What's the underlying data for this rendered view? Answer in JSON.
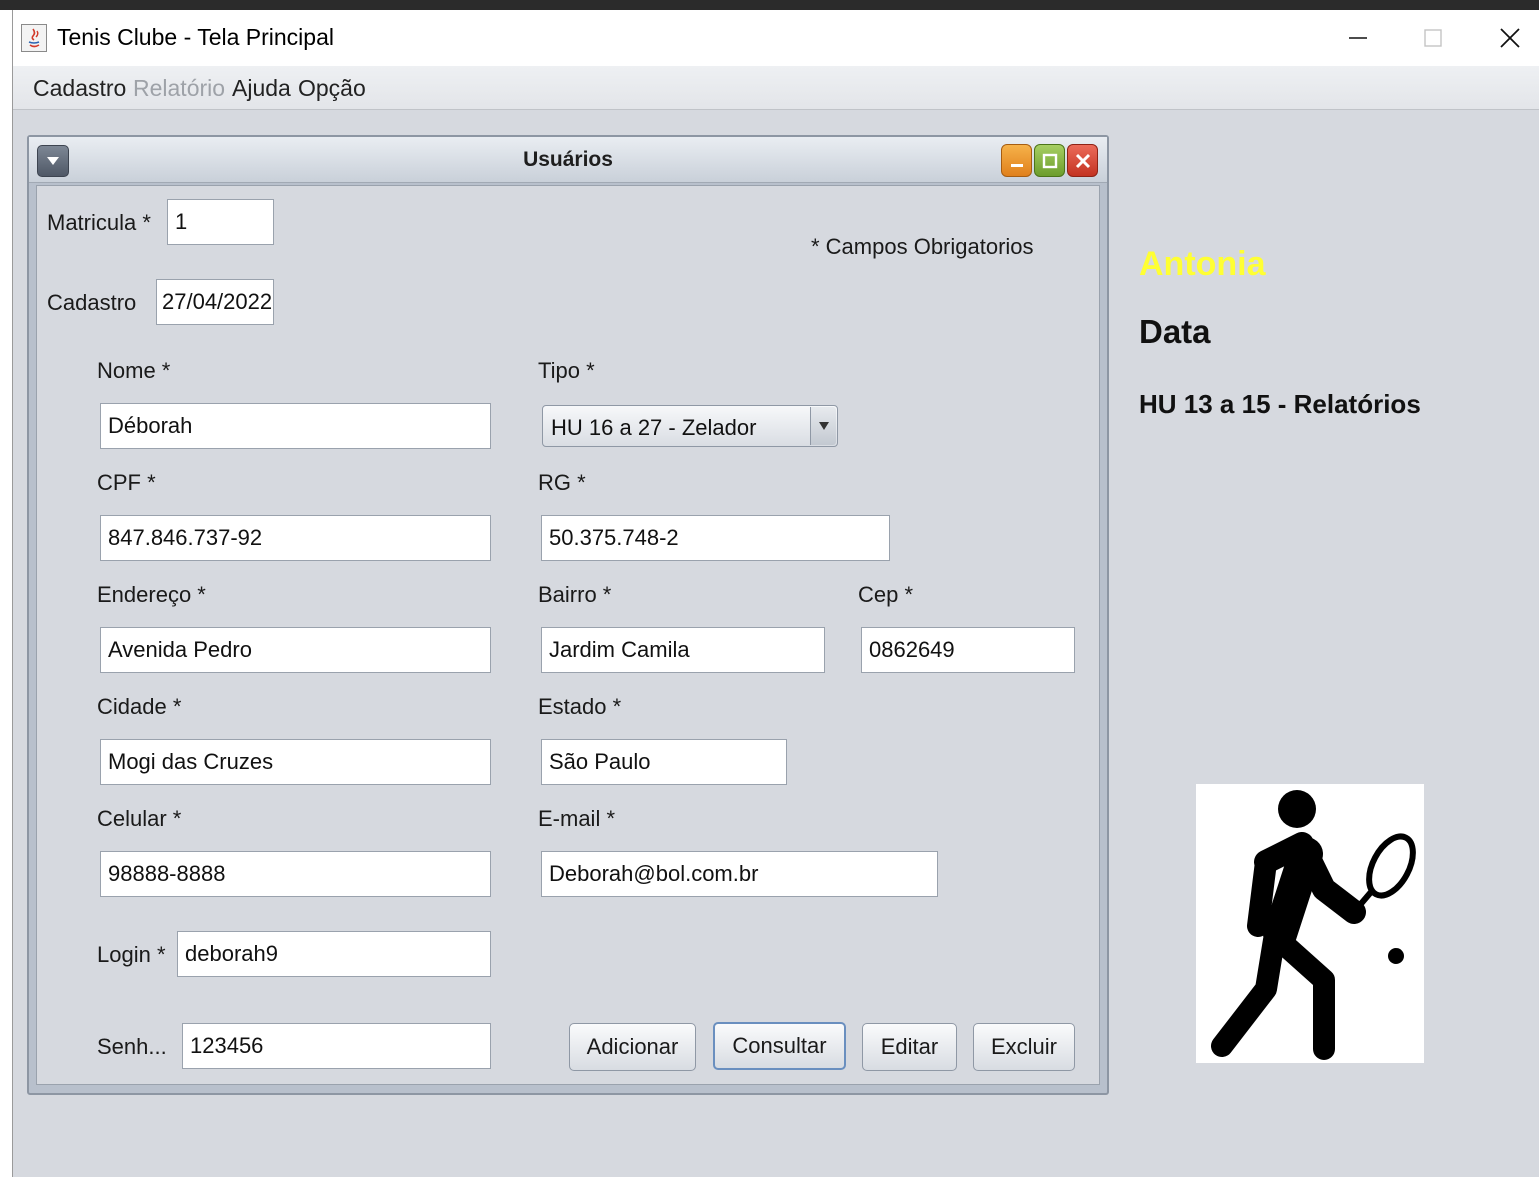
{
  "window": {
    "title": "Tenis Clube  -  Tela Principal",
    "controls": [
      "minimize-icon",
      "maximize-icon",
      "close-icon"
    ]
  },
  "menu": {
    "cadastro": "Cadastro",
    "relatorio": "Relatório",
    "ajuda": "Ajuda",
    "opcao": "Opção"
  },
  "internal_frame": {
    "title": "Usuários",
    "required_note": "* Campos Obrigatorios"
  },
  "form": {
    "matricula": {
      "label": "Matricula *",
      "value": "1"
    },
    "cadastro": {
      "label": "Cadastro",
      "value": "27/04/2022"
    },
    "nome": {
      "label": "Nome *",
      "value": "Déborah"
    },
    "tipo": {
      "label": "Tipo *",
      "value": "HU 16 a 27 - Zelador"
    },
    "cpf": {
      "label": "CPF *",
      "value": "847.846.737-92"
    },
    "rg": {
      "label": "RG *",
      "value": "50.375.748-2"
    },
    "endereco": {
      "label": "Endereço *",
      "value": "Avenida Pedro"
    },
    "bairro": {
      "label": "Bairro *",
      "value": "Jardim Camila"
    },
    "cep": {
      "label": "Cep *",
      "value": "0862649"
    },
    "cidade": {
      "label": "Cidade *",
      "value": "Mogi das Cruzes"
    },
    "estado": {
      "label": "Estado *",
      "value": "São Paulo"
    },
    "celular": {
      "label": "Celular *",
      "value": "98888-8888"
    },
    "email": {
      "label": "E-mail *",
      "value": "Deborah@bol.com.br"
    },
    "login": {
      "label": "Login *",
      "value": "deborah9"
    },
    "senha": {
      "label": "Senh...",
      "value": "123456"
    }
  },
  "buttons": {
    "adicionar": "Adicionar",
    "consultar": "Consultar",
    "editar": "Editar",
    "excluir": "Excluir"
  },
  "side_panel": {
    "user": "Antonia",
    "date": "Data",
    "info": "HU 13 a 15 - Relatórios",
    "image": "tennis-player-icon"
  },
  "colors": {
    "user_name": "#ffff33",
    "background": "#d6d9df"
  }
}
